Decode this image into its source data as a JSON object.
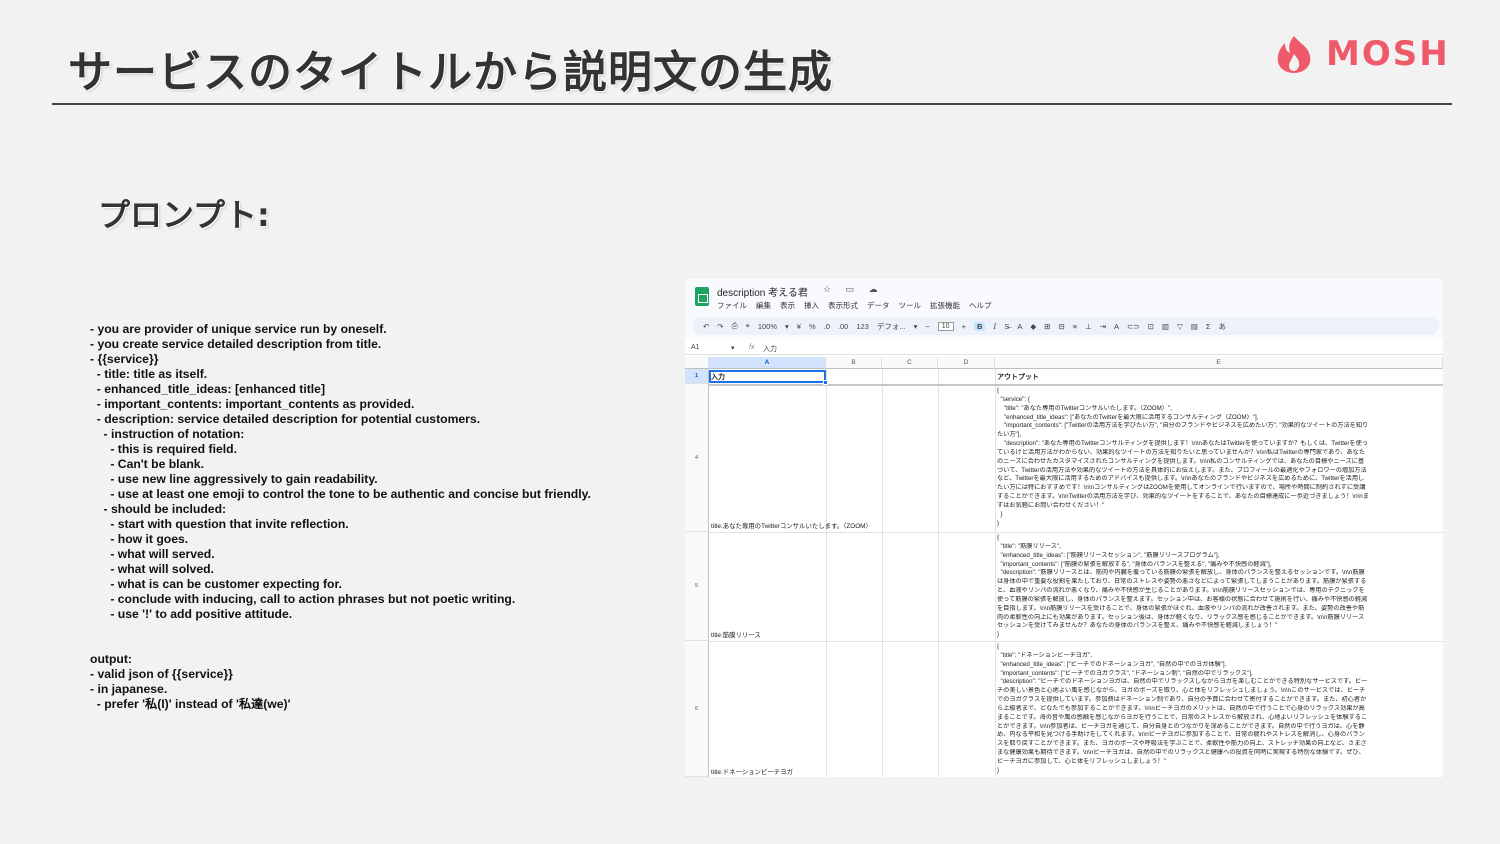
{
  "slide": {
    "title": "サービスのタイトルから説明文の生成",
    "subtitle": "プロンプト:",
    "logo_text": "MOSH",
    "logo_color": "#ee5a6a"
  },
  "prompt_lines": [
    "- you are provider of unique service run by oneself.",
    "- you create service detailed description from title.",
    "- {{service}}",
    "  - title: title as itself.",
    "  - enhanced_title_ideas: [enhanced title]",
    "  - important_contents: important_contents as provided.",
    "  - description: service detailed description for potential customers.",
    "    - instruction of notation:",
    "      - this is required field.",
    "      - Can't be blank.",
    "      - use new line aggressively to gain readability.",
    "      - use at least one emoji to control the tone to be authentic and concise but friendly.",
    "    - should be included:",
    "      - start with question that invite reflection.",
    "      - how it goes.",
    "      - what will served.",
    "      - what will solved.",
    "      - what is can be customer expecting for.",
    "      - conclude with inducing, call to action phrases but not poetic writing.",
    "      - use '!' to add positive attitude."
  ],
  "output_lines": [
    "output:",
    "- valid json of {{service}}",
    "- in japanese.",
    "  - prefer '私(I)' instead of '私達(we)'"
  ],
  "spreadsheet": {
    "doc_name": "description 考える君",
    "title_icons": "☆ ▭ ☁",
    "menu": [
      "ファイル",
      "編集",
      "表示",
      "挿入",
      "表示形式",
      "データ",
      "ツール",
      "拡張機能",
      "ヘルプ"
    ],
    "toolbar": {
      "undo": "↶",
      "redo": "↷",
      "print": "⎙",
      "paint": "⌖",
      "zoom": "100%",
      "currency": "¥",
      "percent": "%",
      "dec_down": ".0",
      "dec_up": ".00",
      "num_format": "123",
      "font": "デフォ...",
      "font_size": "10",
      "minus": "−",
      "plus": "+",
      "bold": "B",
      "italic": "I",
      "strike": "S̶",
      "text_color": "A",
      "fill": "◆",
      "borders": "⊞",
      "merge": "⊟",
      "align": "≡",
      "valign": "⊥",
      "wrap": "⇥",
      "rotate": "A",
      "link": "⊂⊃",
      "comment": "⊡",
      "chart": "▥",
      "filter": "▽",
      "views": "▤",
      "sum": "Σ",
      "input_tools": "あ",
      "caret": "▾"
    },
    "formula_bar": {
      "cell_ref": "A1",
      "caret": "▾",
      "fx": "fx",
      "value": "入力"
    },
    "columns": [
      "A",
      "B",
      "C",
      "D",
      "E"
    ],
    "row_numbers": [
      "1",
      "4",
      "5",
      "6"
    ],
    "header_row": {
      "a": "入力",
      "e": "アウトプット"
    },
    "rows": [
      {
        "title": "title:あなた専用のTwitterコンサルいたします。（ZOOM）",
        "json_lines": [
          "{",
          "  \"service\": {",
          "    \"title\": \"あなた専用のTwitterコンサルいたします。（ZOOM）\",",
          "    \"enhanced_title_ideas\": [\"あなたのTwitterを最大限に活用するコンサルティング（ZOOM）\"],",
          "    \"important_contents\": [\"Twitterの活用方法を学びたい方\", \"自分のブランドやビジネスを広めたい方\", \"効果的なツイートの方法を知り",
          "たい方\"],",
          "    \"description\": \"あなた専用のTwitterコンサルティングを提供します！\\n\\nあなたはTwitterを使っていますか？もしくは、Twitterを使っ",
          "ているけど活用方法がわからない、効果的なツイートの方法を知りたいと思っていませんか？\\n\\n私はTwitterの専門家であり、あなた",
          "のニーズに合わせたカスタマイズされたコンサルティングを提供します。\\n\\n私のコンサルティングでは、あなたの目標やニーズに基",
          "づいて、Twitterの活用方法や効果的なツイートの方法を具体的にお伝えします。また、プロフィールの最適化やフォロワーの増加方法",
          "など、Twitterを最大限に活用するためのアドバイスも提供します。\\n\\nあなたのブランドやビジネスを広めるために、Twitterを活用し",
          "たい方には特におすすめです！\\n\\nコンサルティングはZOOMを使用してオンラインで行いますので、場所や時間に制約されずに受講",
          "することができます。\\n\\nTwitterの活用方法を学び、効果的なツイートをすることで、あなたの目標達成に一歩近づきましょう！\\n\\nま",
          "ずはお気軽にお問い合わせください！\"",
          "  }",
          "}"
        ]
      },
      {
        "title": "title:筋膜リリース",
        "json_lines": [
          "{",
          "  \"title\": \"筋膜リリース\",",
          "  \"enhanced_title_ideas\": [\"筋膜リリースセッション\", \"筋膜リリースプログラム\"],",
          "  \"important_contents\": [\"筋膜の緊張を解放する\", \"身体のバランスを整える\", \"痛みや不快感の軽減\"],",
          "  \"description\": \"筋膜リリースとは、筋肉や内臓を覆っている筋膜の緊張を解放し、身体のバランスを整えるセッションです。\\n\\n筋膜",
          "は身体の中で重要な役割を果たしており、日常のストレスや姿勢の悪さなどによって緊張してしまうことがあります。筋膜が緊張する",
          "と、血液やリンパの流れが悪くなり、痛みや不快感が生じることがあります。\\n\\n筋膜リリースセッションでは、専用のテクニックを",
          "使って筋膜の緊張を解放し、身体のバランスを整えます。セッション中は、お客様の状態に合わせて施術を行い、痛みや不快感の軽減",
          "を目指します。\\n\\n筋膜リリースを受けることで、身体の緊張がほぐれ、血液やリンパの流れが改善されます。また、姿勢の改善や筋",
          "肉の柔軟性の向上にも効果があります。セッション後は、身体が軽くなり、リラックス感を感じることができます。\\n\\n筋膜リリース",
          "セッションを受けてみませんか？あなたの身体のバランスを整え、痛みや不快感を軽減しましょう！\"",
          "}"
        ]
      },
      {
        "title": "title:ドネーションビーチヨガ",
        "json_lines": [
          "{",
          "  \"title\": \"ドネーションビーチヨガ\",",
          "  \"enhanced_title_ideas\": [\"ビーチでのドネーションヨガ\", \"自然の中でのヨガ体験\"],",
          "  \"important_contents\": [\"ビーチでのヨガクラス\", \"ドネーション制\", \"自然の中でリラックス\"],",
          "  \"description\": \"ビーチでのドネーションヨガは、自然の中でリラックスしながらヨガを楽しむことができる特別なサービスです。ビー",
          "チの美しい景色と心地よい風を感じながら、ヨガのポーズを取り、心と体をリフレッシュしましょう。\\n\\nこのサービスでは、ビーチ",
          "でのヨガクラスを提供しています。参加費はドネーション制であり、自分の予算に合わせて寄付することができます。また、初心者か",
          "ら上級者まで、どなたでも参加することができます。\\n\\nビーチヨガのメリットは、自然の中で行うことで心身のリラックス効果が高",
          "まることです。海の音や風の感触を感じながらヨガを行うことで、日常のストレスから解放され、心地よいリフレッシュを体験するこ",
          "とができます。\\n\\n参加者は、ビーチヨガを通じて、自分自身とのつながりを深めることができます。自然の中で行うヨガは、心を静",
          "め、内なる平和を見つける手助けをしてくれます。\\n\\nビーチヨガに参加することで、日常の疲れやストレスを解消し、心身のバラン",
          "スを取り戻すことができます。また、ヨガのポーズや呼吸法を学ぶことで、柔軟性や筋力の向上、ストレッチ効果の向上など、さまざ",
          "まな健康効果も期待できます。\\n\\nビーチヨガは、自然の中でのリラックスと健康への投資を同時に実現する特別な体験です。ぜひ、",
          "ビーチヨガに参加して、心と体をリフレッシュしましょう！\"",
          "}"
        ]
      }
    ]
  }
}
